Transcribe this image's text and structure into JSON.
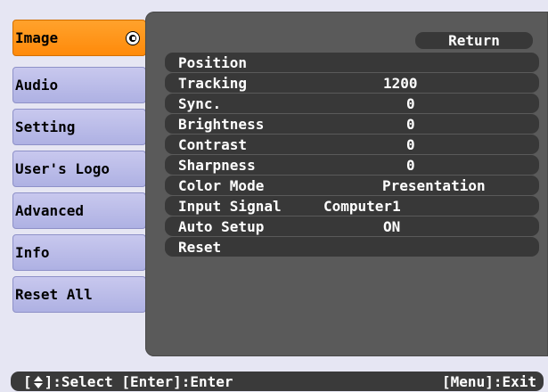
{
  "menu": {
    "items": [
      {
        "label": "Image",
        "selected": true
      },
      {
        "label": "Audio",
        "selected": false
      },
      {
        "label": "Setting",
        "selected": false
      },
      {
        "label": "User's Logo",
        "selected": false
      },
      {
        "label": "Advanced",
        "selected": false
      },
      {
        "label": "Info",
        "selected": false
      },
      {
        "label": "Reset All",
        "selected": false
      }
    ]
  },
  "panel": {
    "return_label": "Return",
    "rows": [
      {
        "name": "Position",
        "value": ""
      },
      {
        "name": "Tracking",
        "value": "1200"
      },
      {
        "name": "Sync.",
        "value": "0"
      },
      {
        "name": "Brightness",
        "value": "0"
      },
      {
        "name": "Contrast",
        "value": "0"
      },
      {
        "name": "Sharpness",
        "value": "0"
      },
      {
        "name": "Color Mode",
        "value": "Presentation"
      },
      {
        "name": "Input Signal",
        "value": "Computer1"
      },
      {
        "name": "Auto Setup",
        "value": "ON"
      },
      {
        "name": "Reset",
        "value": ""
      }
    ]
  },
  "status": {
    "left_open": "[",
    "left_rest": "]:Select [Enter]:Enter",
    "right": "[Menu]:Exit"
  },
  "icons": {
    "enter": "enter-icon",
    "updown": "updown-arrows-icon"
  },
  "colors": {
    "selected_menu": "#ff9418",
    "menu": "#b9bbe8",
    "panel": "#5a5a5a",
    "row": "#383838",
    "background": "#e6e6f3"
  }
}
